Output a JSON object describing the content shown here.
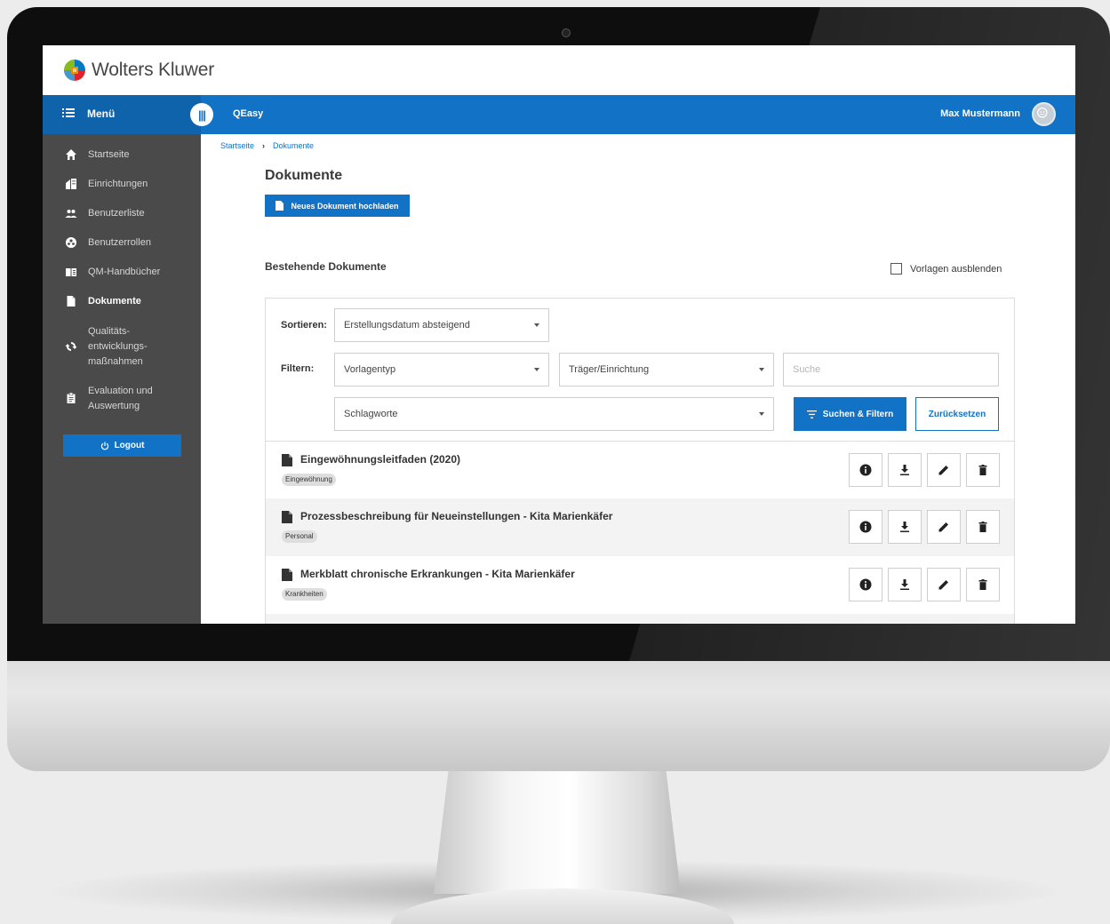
{
  "brand": {
    "name": "Wolters Kluwer"
  },
  "appbar": {
    "menu_label": "Menü",
    "toggle_glyph": "|||",
    "app_name": "QEasy",
    "user_name": "Max Mustermann"
  },
  "sidebar": {
    "items": [
      {
        "label": "Startseite",
        "icon": "home-icon"
      },
      {
        "label": "Einrichtungen",
        "icon": "facility-icon"
      },
      {
        "label": "Benutzerliste",
        "icon": "people-icon"
      },
      {
        "label": "Benutzerrollen",
        "icon": "roles-icon"
      },
      {
        "label": "QM-Handbücher",
        "icon": "book-icon"
      },
      {
        "label": "Dokumente",
        "icon": "document-icon",
        "active": true
      },
      {
        "label": "Qualitäts-entwicklungs-maßnahmen",
        "lines": [
          "Qualitäts-",
          "entwicklungs-",
          "maßnahmen"
        ],
        "icon": "sync-icon"
      },
      {
        "label": "Evaluation und Auswertung",
        "lines": [
          "Evaluation und",
          "Auswertung"
        ],
        "icon": "clipboard-icon"
      }
    ],
    "logout_label": "Logout"
  },
  "breadcrumb": {
    "items": [
      "Startseite",
      "Dokumente"
    ],
    "separator": "›"
  },
  "page": {
    "title": "Dokumente",
    "upload_button": "Neues Dokument hochladen",
    "section_title": "Bestehende Dokumente",
    "hide_templates_label": "Vorlagen ausblenden",
    "hide_templates_checked": false
  },
  "filters": {
    "sort_label": "Sortieren:",
    "sort_value": "Erstellungsdatum absteigend",
    "filter_label": "Filtern:",
    "template_type": "Vorlagentyp",
    "provider": "Träger/Einrichtung",
    "search_placeholder": "Suche",
    "keywords": "Schlagworte",
    "search_button": "Suchen & Filtern",
    "reset_button": "Zurücksetzen"
  },
  "documents": [
    {
      "title": "Eingewöhnungsleitfaden (2020)",
      "tag": "Eingewöhnung"
    },
    {
      "title": "Prozessbeschreibung für Neueinstellungen - Kita Marienkäfer",
      "tag": "Personal"
    },
    {
      "title": "Merkblatt chronische Erkrankungen - Kita Marienkäfer",
      "tag": "Krankheiten"
    }
  ],
  "row_actions": [
    "info-icon",
    "download-icon",
    "edit-icon",
    "delete-icon"
  ],
  "colors": {
    "primary": "#1172c6",
    "sidebar": "#4a4a4a",
    "menu_dark": "#0f63ab"
  }
}
